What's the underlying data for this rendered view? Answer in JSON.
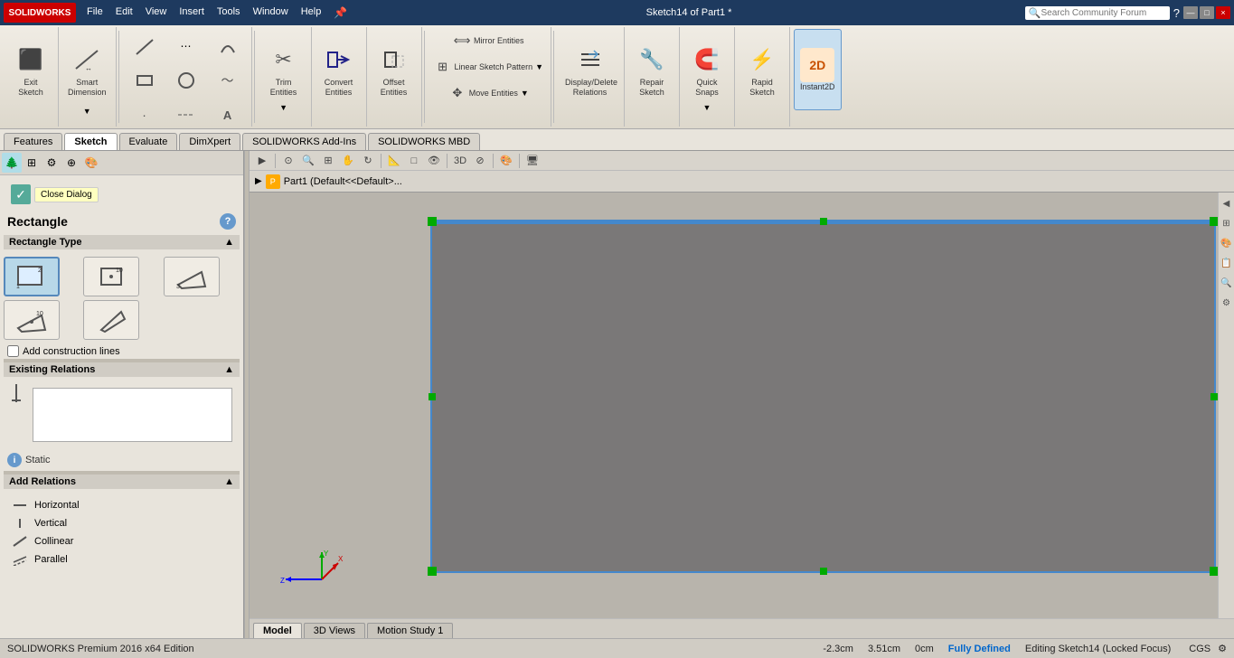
{
  "app": {
    "logo": "SOLIDWORKS",
    "title": "Sketch14 of Part1 *",
    "search_placeholder": "Search Community Forum"
  },
  "menu": {
    "items": [
      "File",
      "Edit",
      "View",
      "Insert",
      "Tools",
      "Window",
      "Help"
    ]
  },
  "toolbar": {
    "groups": [
      {
        "name": "sketch-actions",
        "items": [
          {
            "id": "exit-sketch",
            "label": "Exit\nSketch",
            "icon": "⬛"
          },
          {
            "id": "smart-dimension",
            "label": "Smart\nDimension",
            "icon": "↔"
          }
        ]
      },
      {
        "name": "sketch-tools-1",
        "items": [
          {
            "id": "trim-entities",
            "label": "Trim\nEntities",
            "icon": "✂"
          },
          {
            "id": "convert-entities",
            "label": "Convert\nEntities",
            "icon": "⇄"
          },
          {
            "id": "offset-entities",
            "label": "Offset\nEntities",
            "icon": "⊡"
          }
        ]
      },
      {
        "name": "mirror-tools",
        "items": [
          {
            "id": "mirror-entities",
            "label": "Mirror Entities",
            "icon": "⟺"
          },
          {
            "id": "linear-pattern",
            "label": "Linear Sketch Pattern",
            "icon": "⊞"
          },
          {
            "id": "move-entities",
            "label": "Move Entities",
            "icon": "✥"
          }
        ]
      },
      {
        "name": "display-tools",
        "items": [
          {
            "id": "display-delete",
            "label": "Display/Delete\nRelations",
            "icon": "⇆"
          },
          {
            "id": "repair-sketch",
            "label": "Repair\nSketch",
            "icon": "🔧"
          },
          {
            "id": "quick-snaps",
            "label": "Quick\nSnaps",
            "icon": "🧲"
          },
          {
            "id": "rapid-sketch",
            "label": "Rapid\nSketch",
            "icon": "⚡"
          },
          {
            "id": "instant2d",
            "label": "Instant2D",
            "icon": "2D",
            "active": true
          }
        ]
      }
    ]
  },
  "tabs": {
    "main_tabs": [
      "Features",
      "Sketch",
      "Evaluate",
      "DimXpert",
      "SOLIDWORKS Add-Ins",
      "SOLIDWORKS MBD"
    ],
    "active_tab": "Sketch"
  },
  "left_panel": {
    "panel_title": "Rectangle",
    "help_icon": "?",
    "ok_btn": "✓",
    "close_dialog": "Close Dialog",
    "section_rectangle_type": "Rectangle Type",
    "rect_types": [
      {
        "id": "corner-rect",
        "label": "Corner Rectangle",
        "selected": true
      },
      {
        "id": "center-rect",
        "label": "Center Rectangle",
        "selected": false
      },
      {
        "id": "three-pt-corner",
        "label": "3 Point Corner Rectangle",
        "selected": false
      },
      {
        "id": "three-pt-center",
        "label": "3 Point Center Rectangle",
        "selected": false
      },
      {
        "id": "parallelogram",
        "label": "Parallelogram",
        "selected": false
      }
    ],
    "add_construction": "Add construction lines",
    "section_existing_relations": "Existing Relations",
    "existing_relations_list": [],
    "static_label": "Static",
    "info_icon": "i",
    "section_add_relations": "Add Relations",
    "add_relations_items": [
      {
        "id": "horizontal",
        "label": "Horizontal",
        "icon": "—"
      },
      {
        "id": "vertical",
        "label": "Vertical",
        "icon": "|"
      },
      {
        "id": "collinear",
        "label": "Collinear",
        "icon": "/"
      },
      {
        "id": "parallel",
        "label": "Parallel",
        "icon": "∥"
      }
    ]
  },
  "tree": {
    "item": "Part1  (Default<<Default>..."
  },
  "canvas": {
    "coords": {
      "x": "-2.3cm",
      "y": "3.51cm",
      "z": "0cm"
    }
  },
  "status_bar": {
    "app_name": "SOLIDWORKS Premium 2016 x64 Edition",
    "x_coord": "-2.3cm",
    "y_coord": "3.51cm",
    "z_coord": "0cm",
    "status": "Fully Defined",
    "editing": "Editing Sketch14 (Locked Focus)",
    "units": "CGS"
  },
  "bottom_tabs": {
    "tabs": [
      "Model",
      "3D Views",
      "Motion Study 1"
    ],
    "active": "Model"
  },
  "window_controls": {
    "minimize": "—",
    "maximize": "□",
    "close": "×"
  }
}
